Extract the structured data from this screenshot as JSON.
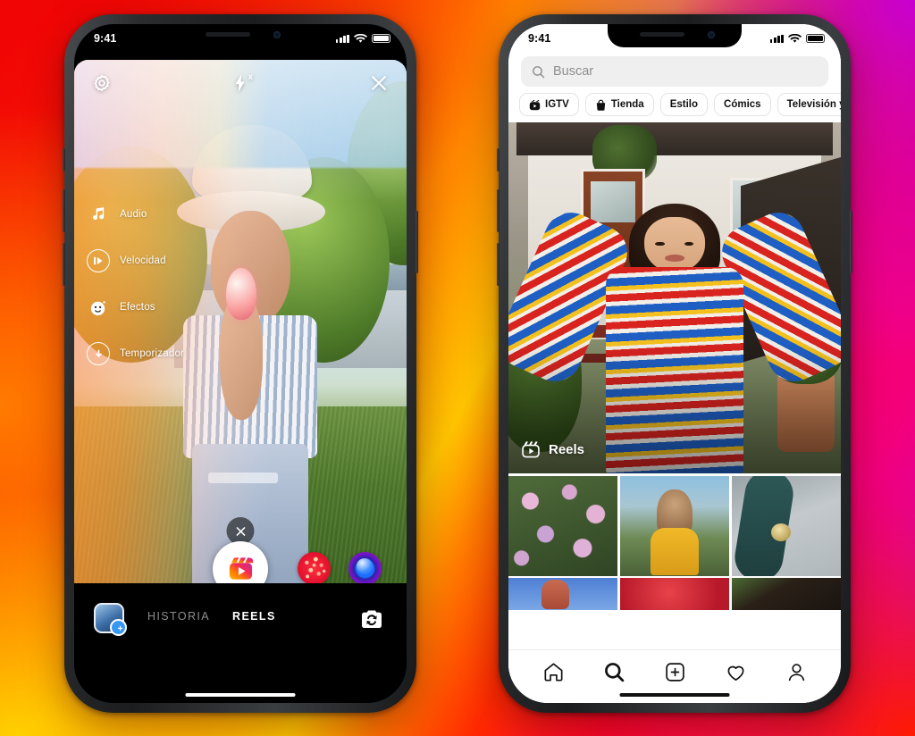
{
  "background": {
    "gradient_colors": [
      "#f40505",
      "#ff5e00",
      "#ffc400",
      "#f0007a",
      "#c000d8"
    ]
  },
  "phones": {
    "left": {
      "name": "Instagram Reels camera",
      "statusbar": {
        "time": "9:41",
        "signal_icon": "cellular-bars-icon",
        "wifi_icon": "wifi-icon",
        "battery_icon": "battery-icon"
      },
      "camera_topbar": {
        "settings_icon": "gear-icon",
        "flash_icon": "flash-off-icon",
        "flash_label": "x",
        "close_icon": "close-icon"
      },
      "side_menu": [
        {
          "label": "Audio",
          "icon": "music-note-icon"
        },
        {
          "label": "Velocidad",
          "icon": "speed-icon"
        },
        {
          "label": "Efectos",
          "icon": "effects-face-icon"
        },
        {
          "label": "Temporizador",
          "icon": "timer-icon"
        }
      ],
      "dismiss_effect_icon": "close-icon",
      "shutter": {
        "icon": "reels-clapper-icon",
        "label": ""
      },
      "effect_thumbnails": [
        {
          "name": "hearts-effect",
          "color": "#e10f2c"
        },
        {
          "name": "orb-effect",
          "color": "#6b16c4"
        }
      ],
      "bottom_bar": {
        "gallery_icon": "gallery-thumbnail-icon",
        "gallery_badge": "+",
        "tabs": [
          {
            "label": "HISTORIA",
            "active": false
          },
          {
            "label": "REELS",
            "active": true
          }
        ],
        "flip_camera_icon": "flip-camera-icon"
      }
    },
    "right": {
      "name": "Instagram Explore",
      "statusbar": {
        "time": "9:41",
        "signal_icon": "cellular-bars-icon",
        "wifi_icon": "wifi-icon",
        "battery_icon": "battery-icon"
      },
      "search": {
        "placeholder": "Buscar",
        "value": "",
        "icon": "search-icon"
      },
      "chips": [
        {
          "label": "IGTV",
          "icon": "igtv-icon"
        },
        {
          "label": "Tienda",
          "icon": "shopping-bag-icon"
        },
        {
          "label": "Estilo",
          "icon": ""
        },
        {
          "label": "Cómics",
          "icon": ""
        },
        {
          "label": "Televisión y cine",
          "icon": ""
        }
      ],
      "hero": {
        "badge_label": "Reels",
        "badge_icon": "reels-clapper-icon"
      },
      "grid": [
        {
          "name": "flowers-post"
        },
        {
          "name": "family-post"
        },
        {
          "name": "skateboard-post"
        },
        {
          "name": "sky-hand-post"
        },
        {
          "name": "red-fabric-post"
        },
        {
          "name": "portrait-post"
        }
      ],
      "nav": [
        {
          "name": "home",
          "icon": "home-icon",
          "active": false
        },
        {
          "name": "search",
          "icon": "search-icon",
          "active": true
        },
        {
          "name": "create",
          "icon": "plus-square-icon",
          "active": false
        },
        {
          "name": "activity",
          "icon": "heart-icon",
          "active": false
        },
        {
          "name": "profile",
          "icon": "person-icon",
          "active": false
        }
      ]
    }
  }
}
